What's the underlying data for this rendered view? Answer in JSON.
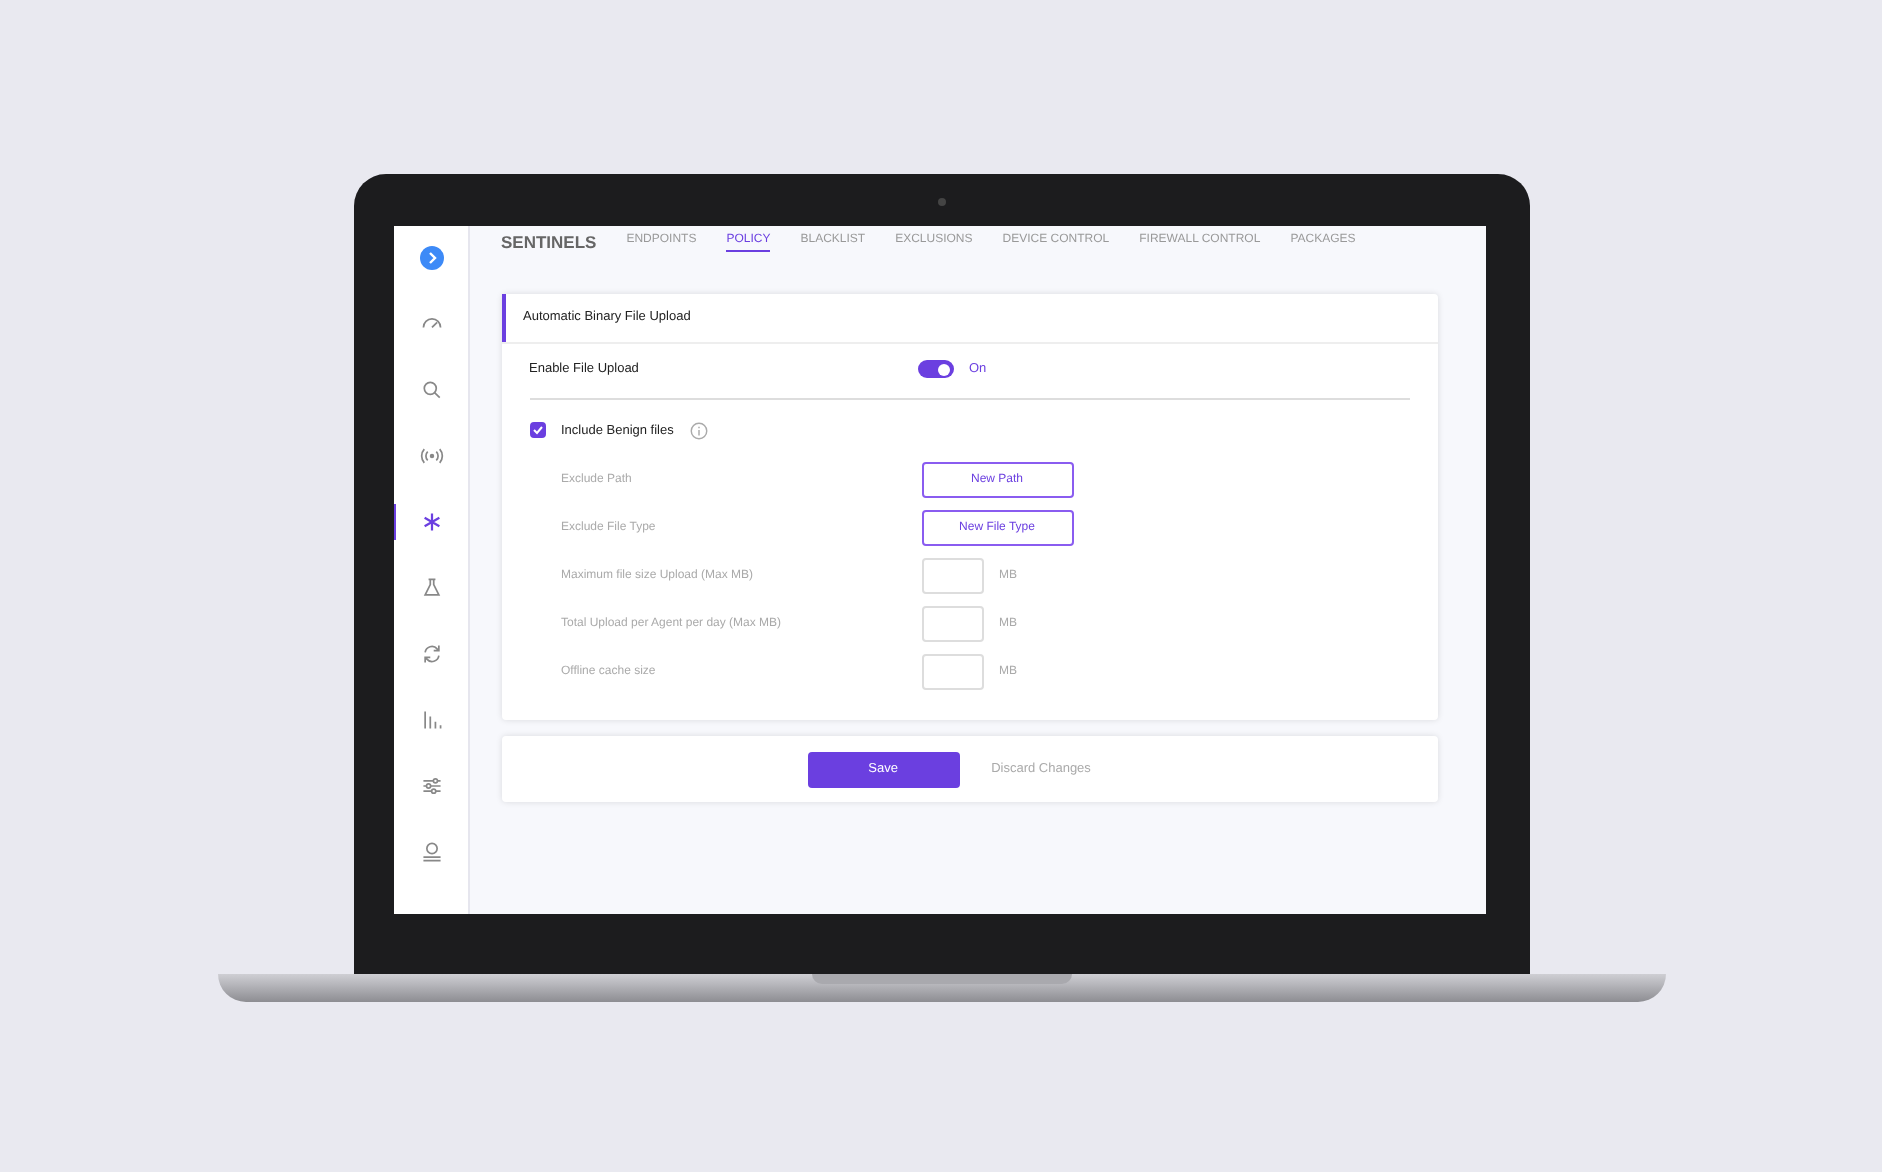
{
  "sidebar": {
    "items": [
      {
        "selected": false
      },
      {
        "selected": false
      },
      {
        "selected": false
      },
      {
        "selected": true
      },
      {
        "selected": false
      },
      {
        "selected": false
      },
      {
        "selected": false
      },
      {
        "selected": false
      },
      {
        "selected": false
      }
    ]
  },
  "brand": "SENTINELS",
  "tabs": [
    {
      "label": "ENDPOINTS",
      "selected": false
    },
    {
      "label": "POLICY",
      "selected": true
    },
    {
      "label": "BLACKLIST",
      "selected": false
    },
    {
      "label": "EXCLUSIONS",
      "selected": false
    },
    {
      "label": "DEVICE CONTROL",
      "selected": false
    },
    {
      "label": "FIREWALL CONTROL",
      "selected": false
    },
    {
      "label": "PACKAGES",
      "selected": false
    }
  ],
  "section": {
    "title": "Automatic Binary File Upload",
    "enable": {
      "label": "Enable File Upload",
      "on": true,
      "state_text": "On"
    },
    "include": {
      "label": "Include Benign files",
      "checked": true
    },
    "rows": [
      {
        "kind": "button",
        "label": "Exclude Path",
        "button": "New Path"
      },
      {
        "kind": "button",
        "label": "Exclude File Type",
        "button": "New File Type"
      },
      {
        "kind": "input",
        "label": "Maximum file size Upload (Max MB)",
        "unit": "MB"
      },
      {
        "kind": "input",
        "label": "Total Upload per Agent per day (Max MB)",
        "unit": "MB"
      },
      {
        "kind": "input",
        "label": "Offline cache size",
        "unit": "MB"
      }
    ]
  },
  "footer": {
    "save": "Save",
    "discard": "Discard Changes"
  }
}
